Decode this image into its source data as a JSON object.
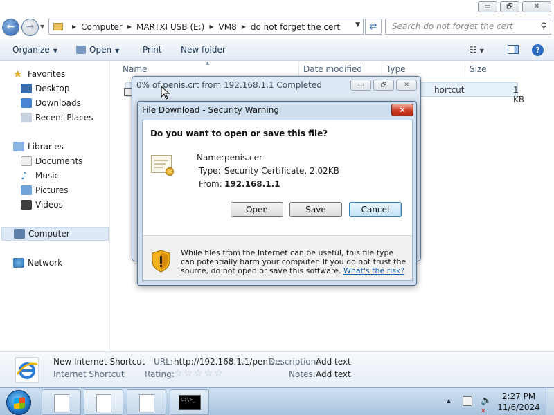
{
  "explorer": {
    "window_controls": {
      "minimize": "▭",
      "maximize": "🗗",
      "close": "✕"
    },
    "breadcrumb": [
      "Computer",
      "MARTXI USB (E:)",
      "VM8",
      "do not forget the cert"
    ],
    "search_placeholder": "Search do not forget the cert",
    "toolbar": {
      "organize": "Organize",
      "open": "Open",
      "print": "Print",
      "new_folder": "New folder"
    },
    "nav": {
      "favorites": "Favorites",
      "desktop": "Desktop",
      "downloads": "Downloads",
      "recent_places": "Recent Places",
      "libraries": "Libraries",
      "documents": "Documents",
      "music": "Music",
      "pictures": "Pictures",
      "videos": "Videos",
      "computer": "Computer",
      "network": "Network"
    },
    "columns": {
      "name": "Name",
      "date_modified": "Date modified",
      "type": "Type",
      "size": "Size"
    },
    "file": {
      "type_visible": "hortcut",
      "size": "1 KB"
    }
  },
  "details_pane": {
    "file_name": "New Internet Shortcut",
    "file_type": "Internet Shortcut",
    "url_label": "URL:",
    "url_value": "http://192.168.1.1/penis...",
    "rating_label": "Rating:",
    "rating_stars": "☆☆☆☆☆",
    "description_label": "Description:",
    "description_value": "Add text",
    "notes_label": "Notes:",
    "notes_value": "Add text"
  },
  "progress_window": {
    "title": "0% of penis.crt from 192.168.1.1 Completed"
  },
  "security_dialog": {
    "title": "File Download - Security Warning",
    "close": "✕",
    "question": "Do you want to open or save this file?",
    "name_label": "Name:",
    "name_value": "penis.cer",
    "type_label": "Type:",
    "type_value": "Security Certificate, 2.02KB",
    "from_label": "From:",
    "from_value": "192.168.1.1",
    "open_button": "Open",
    "save_button": "Save",
    "cancel_button": "Cancel",
    "warning_text": "While files from the Internet can be useful, this file type can potentially harm your computer. If you do not trust the source, do not open or save this software.",
    "risk_link": "What's the risk?"
  },
  "taskbar": {
    "cmd_text": "C:\\>_",
    "time": "2:27 PM",
    "date": "11/6/2024"
  }
}
